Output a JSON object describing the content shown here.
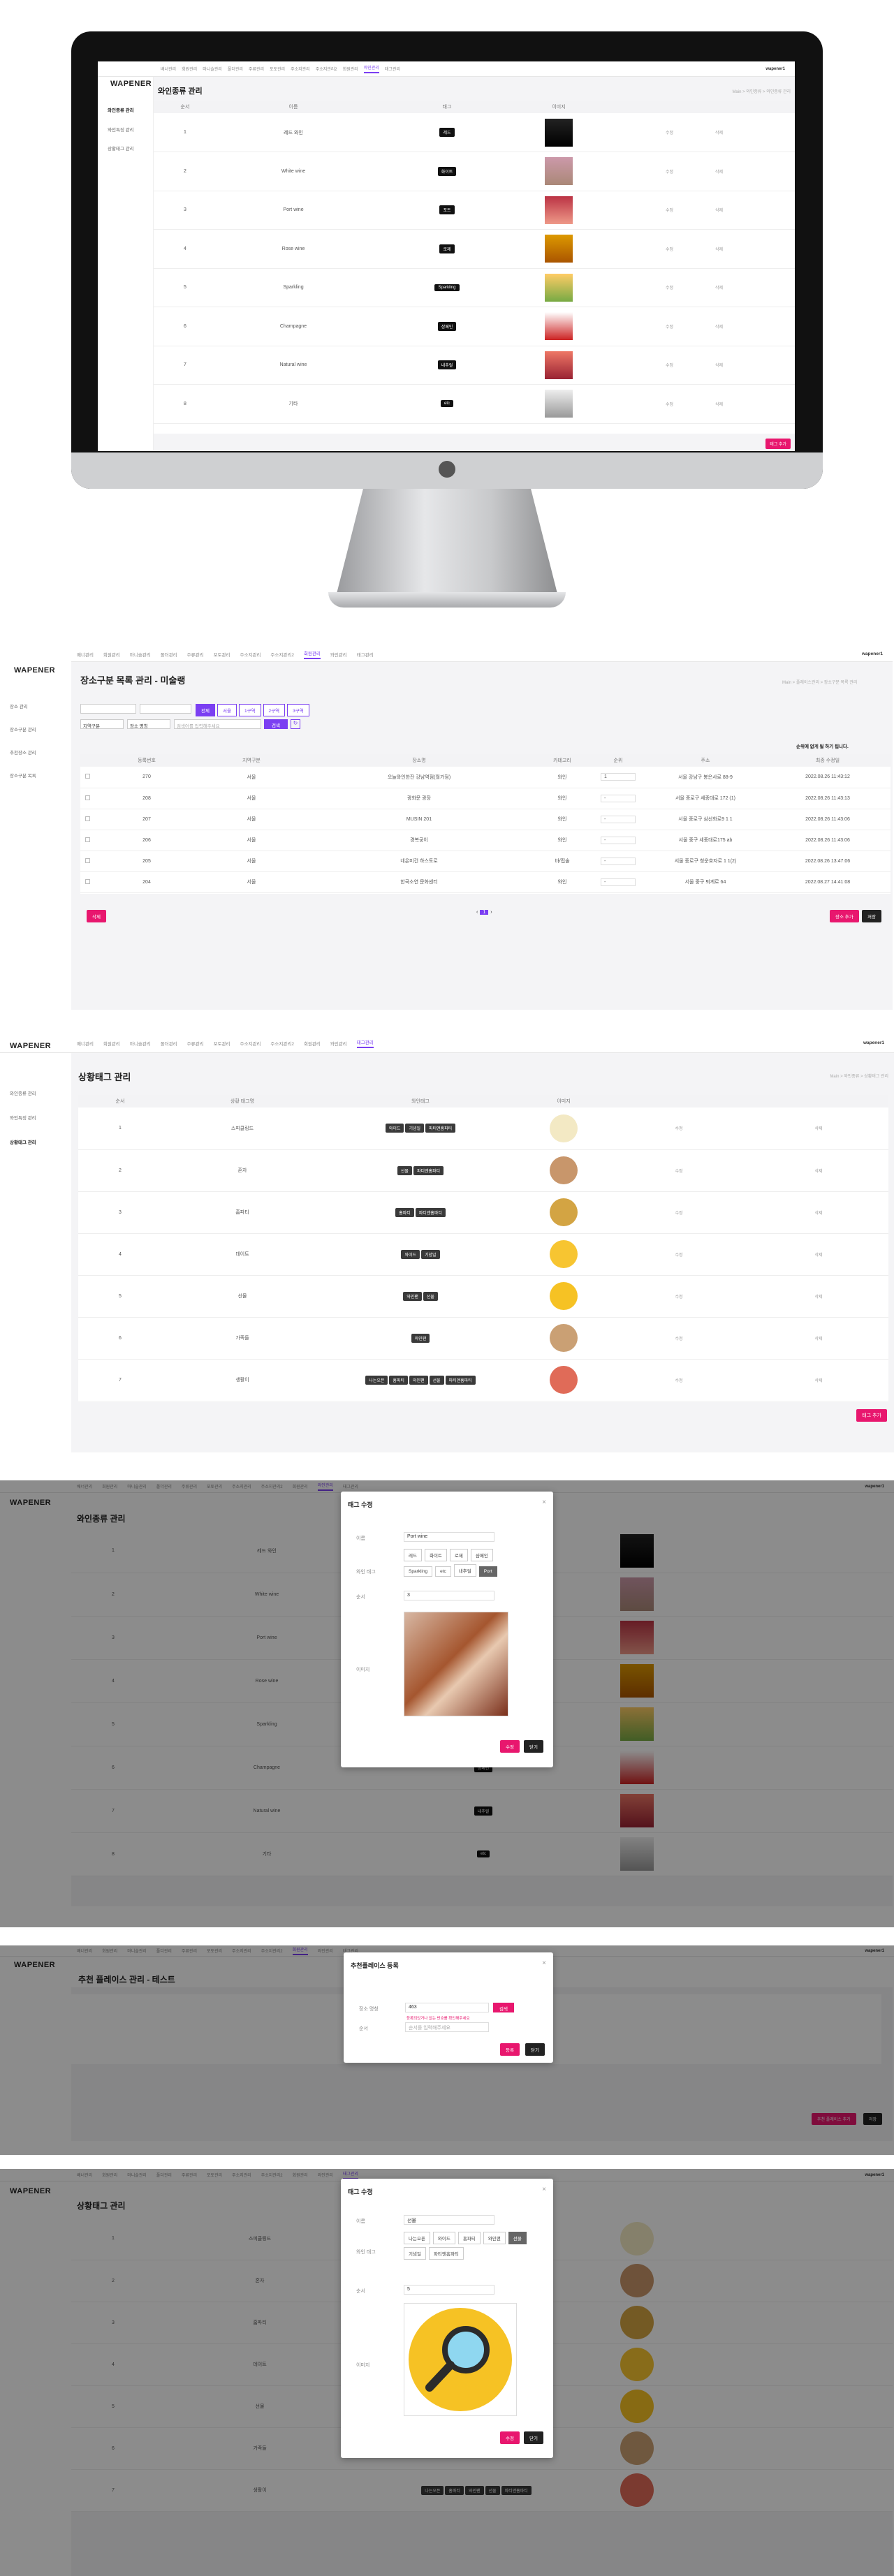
{
  "brand": "WAPENER",
  "nav_items": [
    "배너관리",
    "회원관리",
    "마니슬관리",
    "폴더관리",
    "주류관리",
    "포토관리",
    "주소지관리",
    "주소지관리2",
    "회원관리",
    "와인관리",
    "태그관리"
  ],
  "user_label": "wapener1",
  "logout_label": "로그아웃",
  "wine_screen": {
    "title": "와인종류 관리",
    "breadcrumb": "Main > 와인종류 > 와인종류 관리",
    "side_items": [
      "와인종류 관리",
      "와인특징 관리",
      "상황태그 관리"
    ],
    "columns": [
      "순서",
      "이름",
      "태그",
      "이미지",
      ""
    ],
    "rows": [
      {
        "order": "1",
        "name": "레드 와인",
        "tag": "레드"
      },
      {
        "order": "2",
        "name": "White wine",
        "tag": "화이트"
      },
      {
        "order": "3",
        "name": "Port wine",
        "tag": "포트"
      },
      {
        "order": "4",
        "name": "Rose wine",
        "tag": "로제"
      },
      {
        "order": "5",
        "name": "Sparkling",
        "tag": "Sparkling"
      },
      {
        "order": "6",
        "name": "Champagne",
        "tag": "샴페인"
      },
      {
        "order": "7",
        "name": "Natural wine",
        "tag": "내추럴"
      },
      {
        "order": "8",
        "name": "기타",
        "tag": "etc"
      }
    ],
    "edit_label": "수정",
    "delete_label": "삭제",
    "add_button": "태그 추가"
  },
  "place_screen": {
    "title": "장소구분 목록 관리 - 미술랭",
    "breadcrumb": "Main > 플레이스관리 > 장소구분 목록 관리",
    "side_items": [
      "장소 관리",
      "장소구분 관리",
      "추천장소 관리",
      "장소구분 목록"
    ],
    "filter_tabs": [
      "전체",
      "서울",
      "1구역",
      "2구역",
      "3구역"
    ],
    "select_1": "지역구분",
    "select_2": "장소 명칭",
    "search_placeholder": "검색어를 입력해주세요",
    "search_button": "검색",
    "notice": "순위에 없게 될 하기 됩니다.",
    "columns": [
      "",
      "등록번호",
      "지역구분",
      "장소명",
      "카테고리",
      "순위",
      "주소",
      "최종 수정일"
    ],
    "rows": [
      {
        "id": "270",
        "region": "서울",
        "name": "오늘와인한잔 강남역점(월가점)",
        "cat": "와인",
        "rank": "1",
        "addr": "서울 강남구 봉은사로 88-9",
        "date": "2022.08.26 11:43:12"
      },
      {
        "id": "208",
        "region": "서울",
        "name": "광화문 광장",
        "cat": "와인",
        "rank": "-",
        "addr": "서울 종로구 세종대로 172 (1)",
        "date": "2022.08.26 11:43:13"
      },
      {
        "id": "207",
        "region": "서울",
        "name": "MUSIN 201",
        "cat": "와인",
        "rank": "-",
        "addr": "서울 종로구 삼선화로9 1 1",
        "date": "2022.08.26 11:43:06"
      },
      {
        "id": "206",
        "region": "서울",
        "name": "경복궁이",
        "cat": "와인",
        "rank": "-",
        "addr": "서울 중구 세종대로175 ab",
        "date": "2022.08.26 11:43:06"
      },
      {
        "id": "205",
        "region": "서울",
        "name": "네온미건 하스토로",
        "cat": "바/펍술",
        "rank": "-",
        "addr": "서울 종로구 청운효자로 1 1(2)",
        "date": "2022.08.26 13:47:06"
      },
      {
        "id": "204",
        "region": "서울",
        "name": "한국소연 문화센터",
        "cat": "와인",
        "rank": "-",
        "addr": "서울 중구 퇴계로 64",
        "date": "2022.08.27 14:41:08"
      }
    ],
    "delete_button": "삭제",
    "page_current": "1",
    "add_button": "장소 추가",
    "save_button": "저장"
  },
  "situation_screen": {
    "title": "상황태그 관리",
    "breadcrumb": "Main > 와인종류 > 상황태그 관리",
    "side_items": [
      "와인종류 관리",
      "와인특징 관리",
      "상황태그 관리"
    ],
    "columns": [
      "순서",
      "상황 태그명",
      "와인태그",
      "이미지",
      "",
      ""
    ],
    "rows": [
      {
        "order": "1",
        "name": "스피클링드",
        "tags": [
          "와이드",
          "기념일",
          "파티앤홈파티"
        ]
      },
      {
        "order": "2",
        "name": "혼자",
        "tags": [
          "선물",
          "파티앤홈파티"
        ]
      },
      {
        "order": "3",
        "name": "홈파티",
        "tags": [
          "홈파티",
          "파티앤홈파티"
        ]
      },
      {
        "order": "4",
        "name": "데이트",
        "tags": [
          "와이드",
          "기념일"
        ]
      },
      {
        "order": "5",
        "name": "선물",
        "tags": [
          "와인팬",
          "선물"
        ]
      },
      {
        "order": "6",
        "name": "가족들",
        "tags": [
          "와인팬"
        ]
      },
      {
        "order": "7",
        "name": "생활이",
        "tags": [
          "나는오픈",
          "홈파티",
          "와인팬",
          "선물",
          "파티앤홈파티"
        ]
      }
    ],
    "edit_label": "수정",
    "delete_label": "삭제",
    "add_button": "태그 추가"
  },
  "tag_modal_1": {
    "title": "태그 수정",
    "name_label": "이름",
    "name_value": "Port wine",
    "type_label": "와인 태그",
    "options": [
      "레드",
      "화이트",
      "로제",
      "샴페인",
      "Sparkling",
      "etc",
      "내추럴",
      "Port"
    ],
    "selected_option": "Port",
    "order_label": "순서",
    "order_value": "3",
    "image_label": "이미지",
    "save_button": "수정",
    "cancel_button": "닫기"
  },
  "place_modal": {
    "title": "추천플레이스 등록",
    "field1_label": "장소 명칭",
    "field1_value": "463",
    "field1_error": "등록되었거나 없는 번호를 확인해주세요",
    "field2_label": "순서",
    "field2_placeholder": "순서를 입력해주세요",
    "check_button": "검색",
    "save_button": "등록",
    "cancel_button": "닫기",
    "title_bg": "추천 플레이스 관리 - 테스트",
    "add_button": "추천 플레이스 추가",
    "save_bg": "저장"
  },
  "tag_modal_2": {
    "title": "태그 수정",
    "name_label": "이름",
    "name_value": "선물",
    "type_label": "와인 태그",
    "options": [
      "나는오픈",
      "와이드",
      "홈파티",
      "와인팬",
      "선물",
      "기념일",
      "파티앤홈파티"
    ],
    "selected_option": "선물",
    "order_label": "순서",
    "order_value": "5",
    "image_label": "이미지",
    "save_button": "수정",
    "cancel_button": "닫기"
  },
  "colors": {
    "accent": "#7b3ff2",
    "pink": "#e8176e",
    "dark": "#111111"
  }
}
